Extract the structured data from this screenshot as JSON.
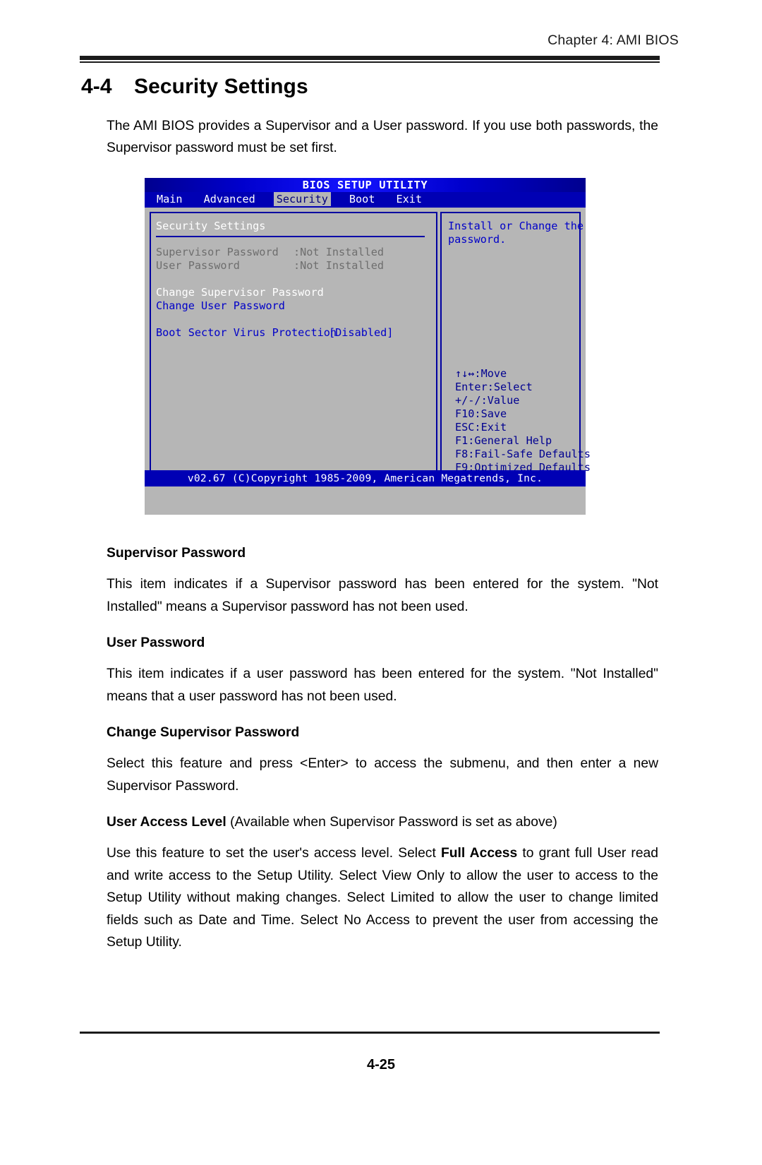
{
  "header": {
    "running_head": "Chapter 4: AMI BIOS"
  },
  "section": {
    "number": "4-4",
    "title": "Security Settings",
    "intro": "The AMI BIOS provides a Supervisor and a User password. If you use both passwords, the Supervisor password must be set first."
  },
  "bios": {
    "title": "BIOS SETUP UTILITY",
    "menu": [
      {
        "label": "Main",
        "active": false
      },
      {
        "label": "Advanced",
        "active": false
      },
      {
        "label": "Security",
        "active": true
      },
      {
        "label": "Boot",
        "active": false
      },
      {
        "label": "Exit",
        "active": false
      }
    ],
    "panel_heading": "Security Settings",
    "status_items": [
      {
        "label": "Supervisor Password",
        "value": ":Not Installed"
      },
      {
        "label": "User Password",
        "value": ":Not Installed"
      }
    ],
    "actions": [
      {
        "label": "Change Supervisor Password",
        "style": "white"
      },
      {
        "label": "Change User Password",
        "style": "blue"
      }
    ],
    "setting": {
      "label": "Boot Sector Virus Protection",
      "value": "[Disabled]"
    },
    "help_text_line1": "Install or Change the",
    "help_text_line2": "password.",
    "key_legend": [
      "↑↓↔:Move",
      "Enter:Select",
      "+/-/:Value",
      "F10:Save",
      "ESC:Exit",
      "F1:General Help",
      "F8:Fail-Safe Defaults",
      "F9:Optimized Defaults"
    ],
    "footer": "v02.67 (C)Copyright 1985-2009, American Megatrends, Inc."
  },
  "sections": [
    {
      "heading": "Supervisor Password",
      "heading_suffix": "",
      "paragraph": "This item indicates if a Supervisor password has been entered for the system. \"Not Installed\" means a Supervisor password has not been used."
    },
    {
      "heading": "User Password",
      "heading_suffix": "",
      "paragraph": "This item indicates if a user password has been entered for the system. \"Not Installed\" means that a user password has not been used."
    },
    {
      "heading": "Change Supervisor Password",
      "heading_suffix": "",
      "paragraph": "Select this feature and press <Enter> to access the submenu, and then enter a new Supervisor Password."
    }
  ],
  "user_access_level": {
    "heading": "User Access Level",
    "heading_suffix": " (Available when Supervisor Password is set as above)",
    "para_part1": "Use this feature to set the user's access level. Select ",
    "para_bold": "Full Access",
    "para_part2": " to grant full User read and write access to the Setup Utility. Select View Only to allow the user to access to the Setup Utility without making changes. Select Limited to allow the user to change limited fields such as Date and Time. Select No Access to prevent the user from accessing the Setup Utility."
  },
  "footer": {
    "page_number": "4-25"
  }
}
